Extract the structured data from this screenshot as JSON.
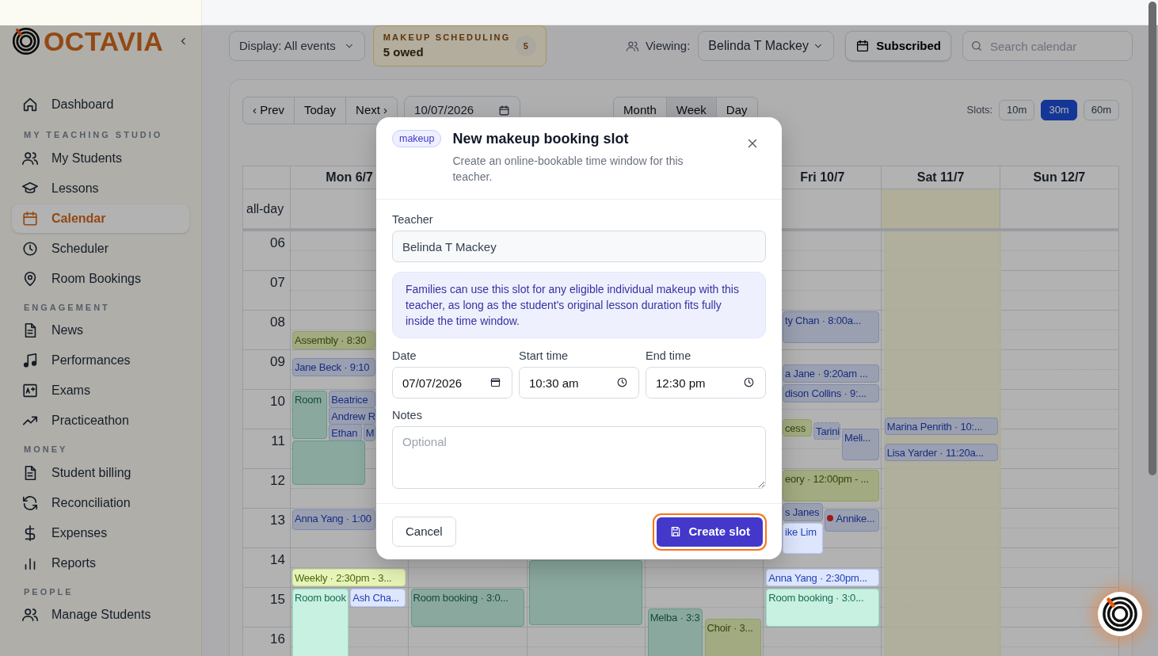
{
  "sidebar": {
    "logo": "OCTAVIA",
    "sections": [
      {
        "items": [
          {
            "label": "Dashboard",
            "selected": false
          }
        ]
      },
      {
        "label": "MY TEACHING STUDIO",
        "items": [
          {
            "label": "My Students",
            "selected": false
          },
          {
            "label": "Lessons",
            "selected": false
          },
          {
            "label": "Calendar",
            "selected": true
          },
          {
            "label": "Scheduler",
            "selected": false
          },
          {
            "label": "Room Bookings",
            "selected": false
          }
        ]
      },
      {
        "label": "ENGAGEMENT",
        "items": [
          {
            "label": "News",
            "selected": false
          },
          {
            "label": "Performances",
            "selected": false
          },
          {
            "label": "Exams",
            "selected": false
          },
          {
            "label": "Practiceathon",
            "selected": false
          }
        ]
      },
      {
        "label": "MONEY",
        "items": [
          {
            "label": "Student billing",
            "selected": false
          },
          {
            "label": "Reconciliation",
            "selected": false
          },
          {
            "label": "Expenses",
            "selected": false
          },
          {
            "label": "Reports",
            "selected": false
          }
        ]
      },
      {
        "label": "PEOPLE",
        "items": [
          {
            "label": "Manage Students",
            "selected": false
          }
        ]
      }
    ]
  },
  "toolbar": {
    "display": "Display: All events",
    "makeup": {
      "title": "MAKEUP SCHEDULING",
      "owed": "5 owed",
      "count": "5"
    },
    "viewing_label": "Viewing:",
    "viewing_value": "Belinda T Mackey",
    "subscribed": "Subscribed",
    "search_placeholder": "Search calendar"
  },
  "calendar": {
    "nav": [
      "‹ Prev",
      "Today",
      "Next ›"
    ],
    "date": "10/07/2026",
    "views": [
      {
        "label": "Month",
        "selected": false
      },
      {
        "label": "Week",
        "selected": true
      },
      {
        "label": "Day",
        "selected": false
      }
    ],
    "slots_label": "Slots:",
    "slots": [
      {
        "label": "10m",
        "selected": false
      },
      {
        "label": "30m",
        "selected": true
      },
      {
        "label": "60m",
        "selected": false
      }
    ],
    "all_day_label": "all-day",
    "hours": [
      "06",
      "07",
      "08",
      "09",
      "10",
      "11",
      "12",
      "13",
      "14",
      "15",
      "16"
    ],
    "days": [
      {
        "label": "Mon 6/7",
        "events": [
          {
            "text": "Assembly · 8:30",
            "kind": "event"
          },
          {
            "text": "Jane Beck · 9:10",
            "kind": "lesson"
          },
          {
            "text": "Room",
            "kind": "room"
          },
          {
            "text": "Beatrice",
            "kind": "lesson"
          },
          {
            "text": "Andrew R",
            "kind": "lesson"
          },
          {
            "text": "Ethan",
            "kind": "lesson"
          },
          {
            "text": "M",
            "kind": "lesson"
          },
          {
            "kind": "room"
          },
          {
            "text": "Anna Yang · 1:00",
            "kind": "lesson"
          },
          {
            "text": "Weekly · 2:30pm - 3...",
            "kind": "event"
          },
          {
            "text": "Room book",
            "kind": "room"
          },
          {
            "text": "Ash Cha...",
            "kind": "lesson"
          }
        ]
      },
      {
        "events": [
          {
            "text": "Room booking · 3:0...",
            "kind": "room"
          }
        ]
      },
      {
        "events": [
          {
            "kind": "room"
          }
        ]
      },
      {
        "events": [
          {
            "text": "Melba · 3:3",
            "kind": "room"
          },
          {
            "text": "Choir · 3...",
            "kind": "event"
          }
        ]
      },
      {
        "label": "Fri 10/7",
        "events": [
          {
            "text": "ty Chan · 8:00a...",
            "kind": "lesson"
          },
          {
            "text": "a Jane · 9:20am ...",
            "kind": "lesson"
          },
          {
            "text": "dison Collins · 9:...",
            "kind": "lesson"
          },
          {
            "text": "cess",
            "kind": "event"
          },
          {
            "text": "Tarini",
            "kind": "lesson",
            "tentative": true
          },
          {
            "text": "Meli...",
            "kind": "lesson"
          },
          {
            "text": "eory · 12:00pm - ...",
            "kind": "event"
          },
          {
            "text": "s Janes",
            "kind": "lesson"
          },
          {
            "text": "Annike...",
            "kind": "lesson",
            "alert": true
          },
          {
            "text": "ike Lim",
            "kind": "lesson"
          },
          {
            "text": "Anna Yang · 2:30pm...",
            "kind": "lesson"
          },
          {
            "text": "Room booking · 3:0...",
            "kind": "room"
          }
        ]
      },
      {
        "label": "Sat 11/7",
        "highlight": true,
        "events": [
          {
            "text": "Marina Penrith · 10:...",
            "kind": "lesson"
          },
          {
            "text": "Lisa Yarder · 11:20a...",
            "kind": "lesson"
          }
        ]
      },
      {
        "label": "Sun 12/7"
      }
    ]
  },
  "modal": {
    "badge": "makeup",
    "title": "New makeup booking slot",
    "subtitle": "Create an online-bookable time window for this teacher.",
    "teacher_label": "Teacher",
    "teacher_value": "Belinda T Mackey",
    "info": "Families can use this slot for any eligible individual makeup with this teacher, as long as the student's original lesson duration fits fully inside the time window.",
    "fields": [
      {
        "label": "Date",
        "value": "07/07/2026",
        "kind": "date"
      },
      {
        "label": "Start time",
        "value": "10:30 am",
        "kind": "time"
      },
      {
        "label": "End time",
        "value": "12:30 pm",
        "kind": "time"
      }
    ],
    "notes_label": "Notes",
    "notes_placeholder": "Optional",
    "cancel": "Cancel",
    "submit": "Create slot"
  }
}
